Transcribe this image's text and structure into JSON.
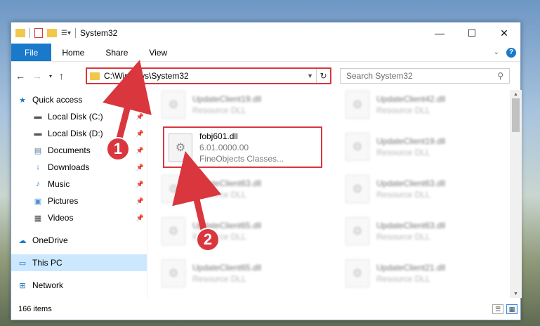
{
  "window": {
    "title": "System32",
    "controls": {
      "minimize": "—",
      "maximize": "☐",
      "close": "✕"
    }
  },
  "ribbon": {
    "tabs": [
      "File",
      "Home",
      "Share",
      "View"
    ]
  },
  "address": {
    "path": "C:\\Windows\\System32"
  },
  "search": {
    "placeholder": "Search System32"
  },
  "sidebar": {
    "items": [
      {
        "label": "Quick access",
        "icon": "star-icon",
        "pinned": false,
        "sub": false
      },
      {
        "label": "Local Disk (C:)",
        "icon": "drive-icon",
        "pinned": true,
        "sub": true
      },
      {
        "label": "Local Disk (D:)",
        "icon": "drive-icon",
        "pinned": true,
        "sub": true
      },
      {
        "label": "Documents",
        "icon": "documents-icon",
        "pinned": true,
        "sub": true
      },
      {
        "label": "Downloads",
        "icon": "download-icon",
        "pinned": true,
        "sub": true
      },
      {
        "label": "Music",
        "icon": "music-icon",
        "pinned": true,
        "sub": true
      },
      {
        "label": "Pictures",
        "icon": "pictures-icon",
        "pinned": true,
        "sub": true
      },
      {
        "label": "Videos",
        "icon": "videos-icon",
        "pinned": true,
        "sub": true
      },
      {
        "label": "OneDrive",
        "icon": "cloud-icon",
        "pinned": false,
        "sub": false
      },
      {
        "label": "This PC",
        "icon": "computer-icon",
        "pinned": false,
        "sub": false,
        "selected": true
      },
      {
        "label": "Network",
        "icon": "network-icon",
        "pinned": false,
        "sub": false
      }
    ]
  },
  "files": {
    "left": [
      {
        "name": "UpdateClient19.dll",
        "type": "Resource DLL"
      },
      {
        "name": "fobj601.dll",
        "type": "6.01.0000.00",
        "desc": "FineObjects Classes..."
      },
      {
        "name": "UpdateClient63.dll",
        "type": "Resource DLL"
      },
      {
        "name": "UpdateClient65.dll",
        "type": "Resource DLL"
      },
      {
        "name": "UpdateClient65.dll",
        "type": "Resource DLL"
      }
    ],
    "right": [
      {
        "name": "UpdateClient42.dll",
        "type": "Resource DLL"
      },
      {
        "name": "UpdateClient19.dll",
        "type": "Resource DLL"
      },
      {
        "name": "UpdateClient63.dll",
        "type": "Resource DLL"
      },
      {
        "name": "UpdateClient63.dll",
        "type": "Resource DLL"
      },
      {
        "name": "UpdateClient21.dll",
        "type": "Resource DLL"
      }
    ]
  },
  "status": {
    "count": "166 items"
  },
  "callouts": [
    "1",
    "2"
  ],
  "colors": {
    "accent": "#1979ca",
    "highlight": "#d9363e",
    "selection": "#cce8ff"
  }
}
